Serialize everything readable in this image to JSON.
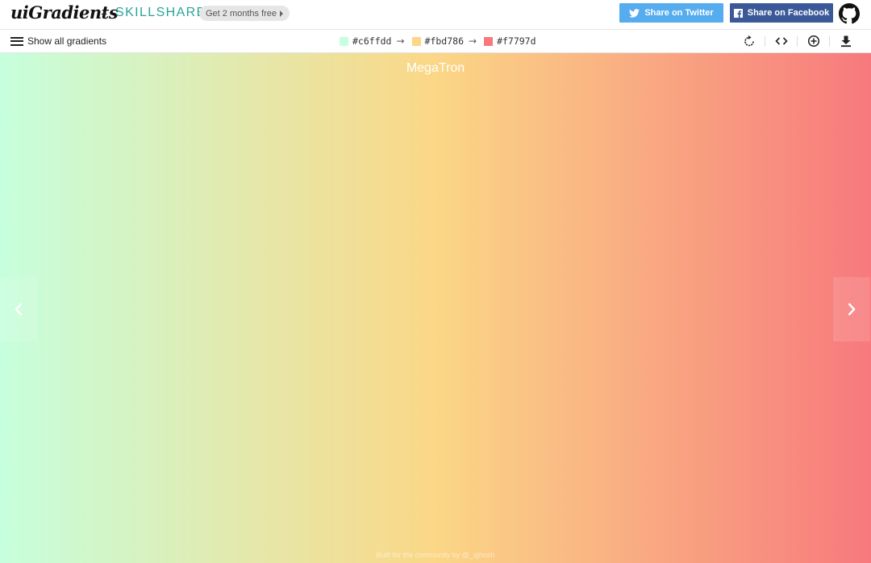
{
  "header": {
    "logo": "uiGradients",
    "plus": "+",
    "partner": "SKILLSHARE",
    "promo_label": "Get 2 months free",
    "twitter_label": "Share on Twitter",
    "facebook_label": "Share on Facebook"
  },
  "toolbar": {
    "menu_label": "Show all gradients",
    "colors": [
      {
        "hex": "#c6ffdd"
      },
      {
        "hex": "#fbd786"
      },
      {
        "hex": "#f7797d"
      }
    ],
    "arrow": "→"
  },
  "gradient": {
    "name": "MegaTron",
    "direction": "to right",
    "stops": [
      "#c6ffdd",
      "#fbd786",
      "#f7797d"
    ]
  },
  "footer": {
    "text": "Built for the community by @_ighosh"
  },
  "icons": {
    "menu": "hamburger-icon",
    "rotate": "rotate-icon",
    "code": "code-icon",
    "add": "plus-circle-icon",
    "download": "download-icon",
    "prev": "chevron-left-icon",
    "next": "chevron-right-icon",
    "twitter": "twitter-icon",
    "facebook": "facebook-icon",
    "github": "github-icon"
  },
  "colors": {
    "twitter": "#55acee",
    "facebook": "#3b5998",
    "skillshare": "#2aa39a"
  }
}
